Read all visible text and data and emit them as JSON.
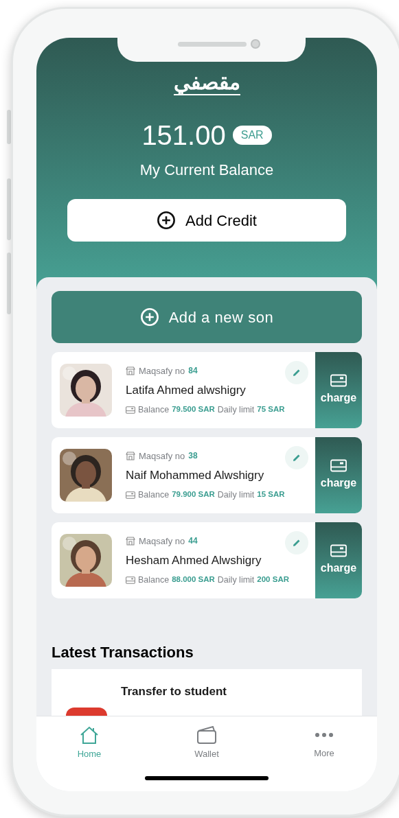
{
  "header": {
    "logo": "مقصفي",
    "balance": "151.00",
    "currency": "SAR",
    "balance_label": "My Current Balance",
    "add_credit_button": "Add Credit"
  },
  "add_son_button": "Add a new son",
  "children": [
    {
      "maqsafy_label": "Maqsafy no",
      "number": "84",
      "name": "Latifa Ahmed alwshigry",
      "balance_label": "Balance",
      "balance": "79.500 SAR",
      "limit_label": "Daily limit",
      "limit": "75 SAR",
      "charge_label": "charge"
    },
    {
      "maqsafy_label": "Maqsafy no",
      "number": "38",
      "name": "Naif Mohammed Alwshigry",
      "balance_label": "Balance",
      "balance": "79.900 SAR",
      "limit_label": "Daily limit",
      "limit": "15 SAR",
      "charge_label": "charge"
    },
    {
      "maqsafy_label": "Maqsafy no",
      "number": "44",
      "name": "Hesham Ahmed Alwshigry",
      "balance_label": "Balance",
      "balance": "88.000 SAR",
      "limit_label": "Daily limit",
      "limit": "200 SAR",
      "charge_label": "charge"
    }
  ],
  "latest_transactions": {
    "title": "Latest Transactions",
    "items": [
      {
        "title": "Transfer to student"
      }
    ]
  },
  "nav": [
    {
      "kind": "home",
      "label": "Home",
      "selected": true
    },
    {
      "kind": "wallet",
      "label": "Wallet",
      "selected": false
    },
    {
      "kind": "more",
      "label": "More",
      "selected": false
    }
  ]
}
